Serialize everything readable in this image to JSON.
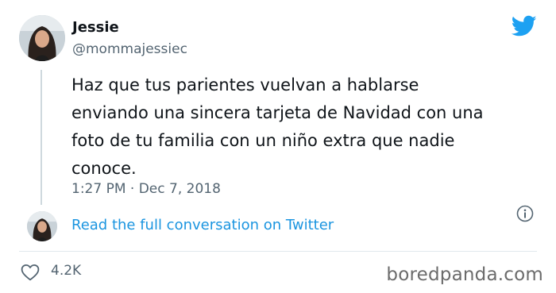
{
  "author": {
    "name": "Jessie",
    "handle": "@mommajessiec"
  },
  "tweet": {
    "lines": [
      "Haz que tus parientes vuelvan a hablarse",
      "enviando una sincera tarjeta de Navidad con una",
      "foto de tu familia con un niño extra que nadie",
      "conoce."
    ],
    "timestamp": "1:27 PM · Dec 7, 2018"
  },
  "conversation_link": "Read the full conversation on Twitter",
  "likes": {
    "count": "4.2K"
  },
  "watermark": "boredpanda.com",
  "icons": {
    "brand": "twitter-bird-icon",
    "info": "info-icon",
    "like": "heart-icon"
  },
  "colors": {
    "twitter_blue": "#1da1f2",
    "link_blue": "#1b95e0",
    "secondary_text": "#536471"
  }
}
